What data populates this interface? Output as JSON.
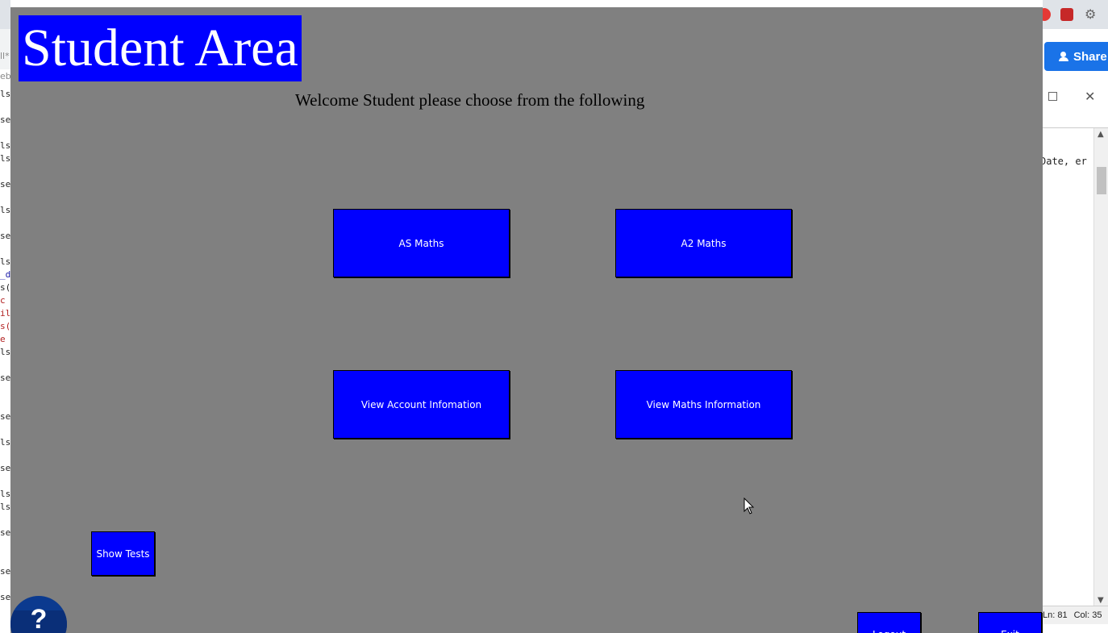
{
  "background": {
    "left_fragments": [
      {
        "text": "ll*",
        "style": "grey"
      },
      {
        "text": "eb",
        "style": "grey"
      },
      {
        "text": "ls",
        "style": ""
      },
      {
        "text": "se",
        "style": ""
      },
      {
        "text": "ls",
        "style": ""
      },
      {
        "text": "ls",
        "style": ""
      },
      {
        "text": "se",
        "style": ""
      },
      {
        "text": "ls",
        "style": ""
      },
      {
        "text": "se",
        "style": ""
      },
      {
        "text": "ls",
        "style": ""
      },
      {
        "text": "_d",
        "style": "blue"
      },
      {
        "text": "s(",
        "style": ""
      },
      {
        "text": "c",
        "style": "red"
      },
      {
        "text": "il",
        "style": "red"
      },
      {
        "text": "s(",
        "style": "red"
      },
      {
        "text": "e",
        "style": "red"
      },
      {
        "text": "ls",
        "style": ""
      },
      {
        "text": "se",
        "style": ""
      },
      {
        "text": "se",
        "style": ""
      },
      {
        "text": "ls",
        "style": ""
      },
      {
        "text": "se",
        "style": ""
      },
      {
        "text": "ls",
        "style": ""
      },
      {
        "text": "ls",
        "style": ""
      },
      {
        "text": "se",
        "style": ""
      },
      {
        "text": "se",
        "style": ""
      },
      {
        "text": "se",
        "style": ""
      }
    ],
    "share_label": "Share",
    "code_snippet": "Date, er",
    "status": {
      "line": "Ln: 81",
      "col": "Col: 35"
    }
  },
  "app": {
    "title": "Student Area",
    "welcome": "Welcome Student please choose from the following",
    "buttons": {
      "as_maths": "AS Maths",
      "a2_maths": "A2 Maths",
      "view_account": "View Account Infomation",
      "view_maths": "View Maths Information",
      "show_tests": "Show Tests",
      "logout": "Logout",
      "exit": "Exit"
    },
    "help_glyph": "?"
  },
  "colors": {
    "window_bg": "#808080",
    "button_bg": "#0000ff",
    "button_text": "#ffffff"
  }
}
